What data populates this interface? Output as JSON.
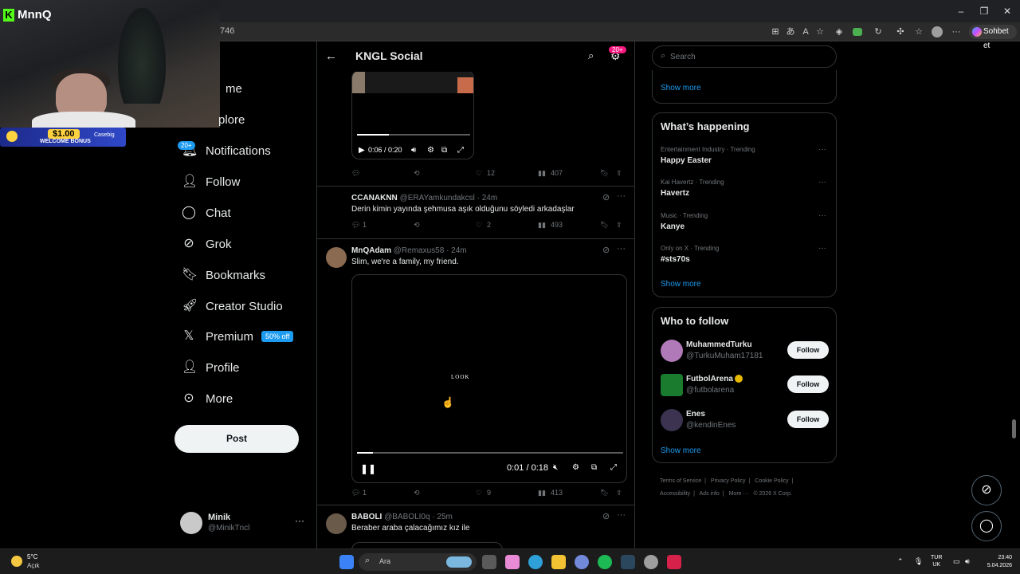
{
  "browser": {
    "address_text": "746",
    "chat_button_label": "Sohbet et",
    "window_controls": {
      "minimize": "–",
      "maximize": "❐",
      "close": "✕"
    }
  },
  "stream_overlay": {
    "channel_name": "MnnQ",
    "channel_logo_letter": "K",
    "bonus_amount": "$1.00",
    "bonus_text": "WELCOME BONUS",
    "bonus_brand": "Casebig"
  },
  "nav": {
    "items": [
      {
        "label": "Home",
        "icon": "home-icon"
      },
      {
        "label": "Explore",
        "icon": "search-icon"
      },
      {
        "label": "Notifications",
        "icon": "bell-icon",
        "badge": "20+"
      },
      {
        "label": "Follow",
        "icon": "person-add-icon"
      },
      {
        "label": "Chat",
        "icon": "chat-icon"
      },
      {
        "label": "Grok",
        "icon": "grok-icon"
      },
      {
        "label": "Bookmarks",
        "icon": "bookmark-icon"
      },
      {
        "label": "Creator Studio",
        "icon": "rocket-icon"
      },
      {
        "label": "Premium",
        "icon": "x-logo-icon",
        "badge": "50% off"
      },
      {
        "label": "Profile",
        "icon": "person-icon"
      },
      {
        "label": "More",
        "icon": "more-circle-icon"
      }
    ],
    "visible_home": "me",
    "visible_explore": "plore",
    "post_button": "Post",
    "account": {
      "name": "Minik",
      "handle": "@MinikTncl",
      "more": "···"
    }
  },
  "feed": {
    "title": "KNGL Social",
    "header_badge": "20+",
    "posts": [
      {
        "video_time": "0:06 / 0:20",
        "video_progress": 0.28,
        "replies": "",
        "reposts": "",
        "likes": "12",
        "views": "407"
      },
      {
        "name": "CCANAKNN",
        "handle": "@ERAYamkundakcsl",
        "time": "· 24m",
        "text": "Derin kimin yayında şehmusa aşık olduğunu  söyledi arkadaşlar",
        "replies": "1",
        "reposts": "",
        "likes": "2",
        "views": "493"
      },
      {
        "name": "MnQAdam",
        "handle": "@Remaxus58",
        "time": "· 24m",
        "text": "Slim, we're a family, my friend.",
        "video_caption": "LOOK",
        "video_time": "0:01 / 0:18",
        "video_progress": 0.06,
        "replies": "1",
        "reposts": "",
        "likes": "9",
        "views": "413"
      },
      {
        "name": "BABOLI",
        "handle": "@BABOLI0q",
        "time": "· 25m",
        "text": "Beraber araba çalacağımız kız ile"
      }
    ]
  },
  "sidebar": {
    "search_placeholder": "Search",
    "top_show_more": "Show more",
    "trends_title": "What’s happening",
    "trends": [
      {
        "category": "Entertainment Industry · Trending",
        "name": "Happy Easter"
      },
      {
        "category": "Kai Havertz · Trending",
        "name": "Havertz"
      },
      {
        "category": "Music · Trending",
        "name": "Kanye"
      },
      {
        "category": "Only on X · Trending",
        "name": "#sts70s"
      }
    ],
    "trends_show_more": "Show more",
    "wtf_title": "Who to follow",
    "wtf": [
      {
        "name": "MuhammedTurku",
        "handle": "@TurkuMuham17181",
        "button": "Follow",
        "avatar_color": "#b07ab8"
      },
      {
        "name": "FutbolArena",
        "handle": "@futbolarena",
        "button": "Follow",
        "avatar_color": "#1a7a2e",
        "verified": true
      },
      {
        "name": "Enes",
        "handle": "@kendinEnes",
        "button": "Follow",
        "avatar_color": "#3b3350"
      }
    ],
    "wtf_show_more": "Show more",
    "footer": [
      "Terms of Service",
      "|",
      "Privacy Policy",
      "|",
      "Cookie Policy",
      "|",
      "Accessibility",
      "|",
      "Ads info",
      "|",
      "More ···",
      "© 2026 X Corp."
    ]
  },
  "taskbar": {
    "weather_temp": "5°C",
    "weather_desc": "Açık",
    "search_label": "Ara",
    "lang_top": "TUR",
    "lang_bottom": "UK",
    "time": "23:40",
    "date": "5.04.2026"
  },
  "colors": {
    "accent": "#1d9bf0",
    "background": "#000000",
    "border": "#2f3336",
    "text_secondary": "#71767b"
  }
}
